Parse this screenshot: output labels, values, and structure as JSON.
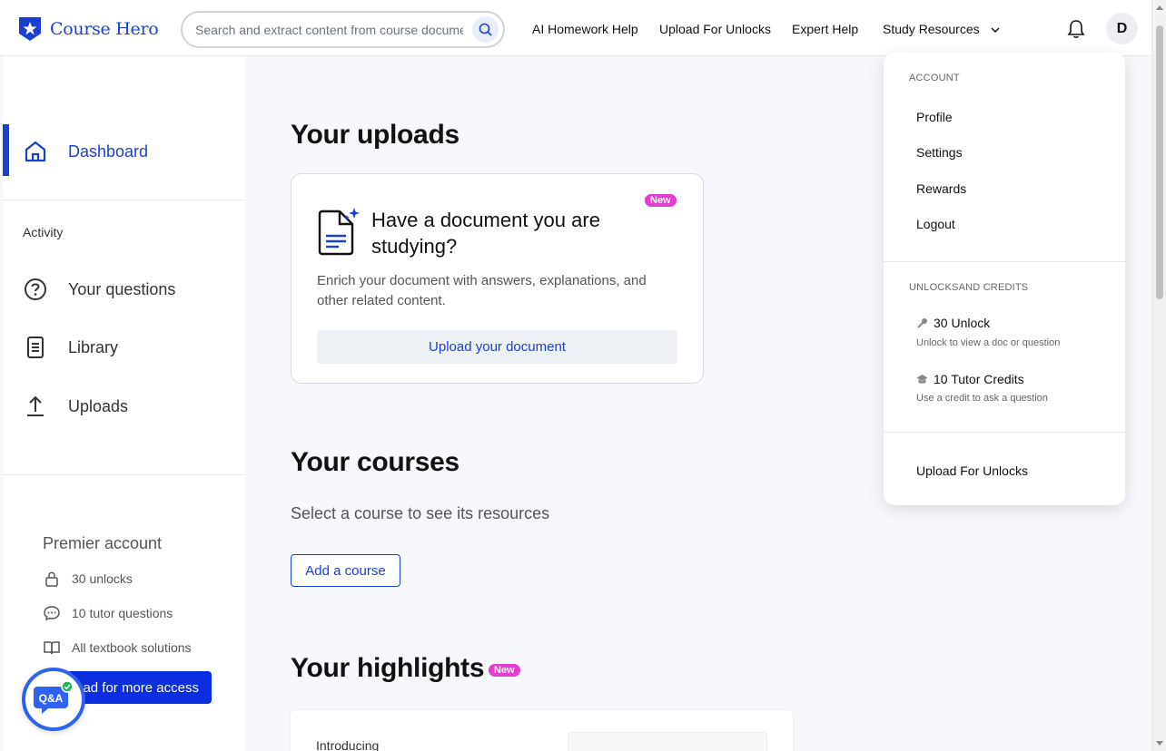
{
  "header": {
    "logo_text": "Course Hero",
    "search_placeholder": "Search and extract content from course documents",
    "nav": [
      "AI Homework Help",
      "Upload For Unlocks",
      "Expert Help",
      "Study Resources"
    ],
    "avatar_initial": "D"
  },
  "sidebar": {
    "dashboard_label": "Dashboard",
    "activity_heading": "Activity",
    "items": [
      "Your questions",
      "Library",
      "Uploads"
    ],
    "premier_title": "Premier account",
    "perks": [
      "30 unlocks",
      "10 tutor questions",
      "All textbook solutions"
    ],
    "upgrade_label": "ad for more access",
    "qa_label": "Q&A"
  },
  "main": {
    "uploads_title": "Your uploads",
    "card": {
      "badge": "New",
      "title": "Have a document you are studying?",
      "description": "Enrich your document with answers, explanations, and other related content.",
      "button": "Upload your document"
    },
    "courses_title": "Your courses",
    "courses_subtitle": "Select a course to see its resources",
    "add_course": "Add a course",
    "highlights_title": "Your highlights",
    "highlights_badge": "New",
    "intro_text": "Introducing"
  },
  "dropdown": {
    "account_heading": "ACCOUNT",
    "account_items": [
      "Profile",
      "Settings",
      "Rewards",
      "Logout"
    ],
    "credits_heading": "UNLOCKSAND CREDITS",
    "unlock_label": "30 Unlock",
    "unlock_sub": "Unlock to view a doc or question",
    "tutor_label": "10 Tutor Credits",
    "tutor_sub": "Use a credit to ask a question",
    "upload_link": "Upload For Unlocks"
  },
  "colors": {
    "brand_blue": "#1b3fd0",
    "badge_pink": "#e23fcf",
    "cta_blue": "#0a2ee0"
  }
}
